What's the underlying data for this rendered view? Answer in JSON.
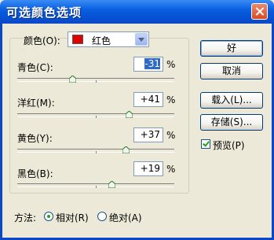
{
  "window": {
    "title": "可选颜色选项"
  },
  "colors": {
    "label": "颜色(O):",
    "selected": "红色",
    "swatch": "#e00000"
  },
  "sliders": [
    {
      "label": "青色(C):",
      "value": "-31",
      "pct": "%",
      "level": -31
    },
    {
      "label": "洋红(M):",
      "value": "+41",
      "pct": "%",
      "level": 41
    },
    {
      "label": "黄色(Y):",
      "value": "+37",
      "pct": "%",
      "level": 37
    },
    {
      "label": "黑色(B):",
      "value": "+19",
      "pct": "%",
      "level": 19
    }
  ],
  "buttons": {
    "ok": "好",
    "cancel": "取消",
    "load": "载入(L)...",
    "save": "存储(S)..."
  },
  "preview": {
    "label": "预览(P)",
    "checked": true
  },
  "method": {
    "label": "方法:",
    "relative": "相对(R)",
    "absolute": "绝对(A)",
    "selected": "relative"
  }
}
